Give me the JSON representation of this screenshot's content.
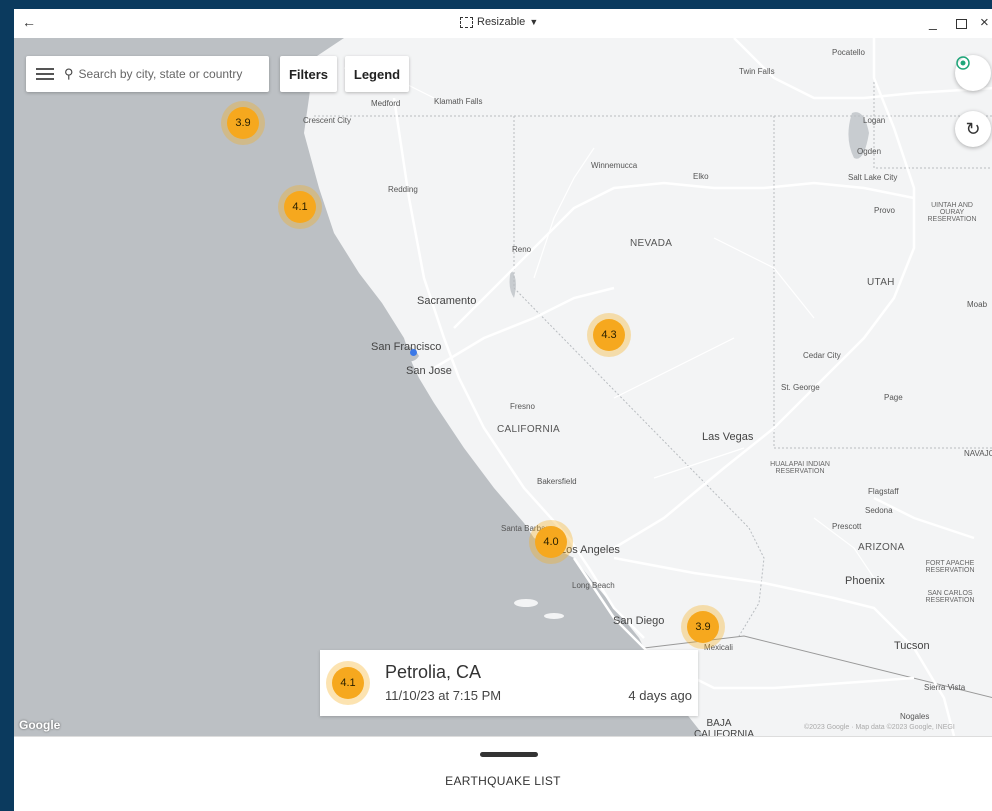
{
  "titlebar": {
    "mode_label": "Resizable"
  },
  "search": {
    "placeholder": "Search by city, state or country"
  },
  "toolbar": {
    "filters_label": "Filters",
    "legend_label": "Legend"
  },
  "map_labels": {
    "pocatello": "Pocatello",
    "twin_falls": "Twin Falls",
    "medford": "Medford",
    "klamath_falls": "Klamath Falls",
    "crescent_city": "Crescent City",
    "logan": "Logan",
    "ogden": "Ogden",
    "salt_lake_city": "Salt Lake City",
    "provo": "Provo",
    "uintah": "UINTAH AND OURAY RESERVATION",
    "winnemucca": "Winnemucca",
    "elko": "Elko",
    "redding": "Redding",
    "nevada": "NEVADA",
    "reno": "Reno",
    "utah": "UTAH",
    "moab": "Moab",
    "sacramento": "Sacramento",
    "san_francisco": "San Francisco",
    "san_jose": "San Jose",
    "cedar_city": "Cedar City",
    "st_george": "St. George",
    "page": "Page",
    "fresno": "Fresno",
    "california": "CALIFORNIA",
    "las_vegas": "Las Vegas",
    "navajo": "NAVAJO",
    "hualapai": "HUALAPAI INDIAN RESERVATION",
    "bakersfield": "Bakersfield",
    "flagstaff": "Flagstaff",
    "sedona": "Sedona",
    "prescott": "Prescott",
    "santa_barbara": "Santa Barbara",
    "los_angeles": "Los Angeles",
    "arizona": "ARIZONA",
    "long_beach": "Long Beach",
    "phoenix": "Phoenix",
    "fort_apache": "FORT APACHE RESERVATION",
    "san_carlos": "SAN CARLOS RESERVATION",
    "san_diego": "San Diego",
    "mexicali": "Mexicali",
    "tucson": "Tucson",
    "sierra_vista": "Sierra Vista",
    "nogales": "Nogales",
    "baja": "BAJA CALIFORNIA"
  },
  "quakes": [
    {
      "mag": "3.9"
    },
    {
      "mag": "4.1"
    },
    {
      "mag": "4.3"
    },
    {
      "mag": "4.0"
    },
    {
      "mag": "3.9"
    }
  ],
  "selected_quake": {
    "mag": "4.1",
    "place": "Petrolia, CA",
    "datetime": "11/10/23 at 7:15 PM",
    "ago": "4 days ago"
  },
  "map_footer": {
    "logo": "Google",
    "copyright": "©2023 Google · Map data ©2023 Google, INEGI"
  },
  "bottom_sheet": {
    "title": "EARTHQUAKE LIST"
  },
  "colors": {
    "marker": "#f6a81e",
    "marker_halo": "#f7ae20",
    "ocean": "#bcc0c4",
    "land": "#f3f4f5",
    "my_location": "#3b78e7"
  }
}
